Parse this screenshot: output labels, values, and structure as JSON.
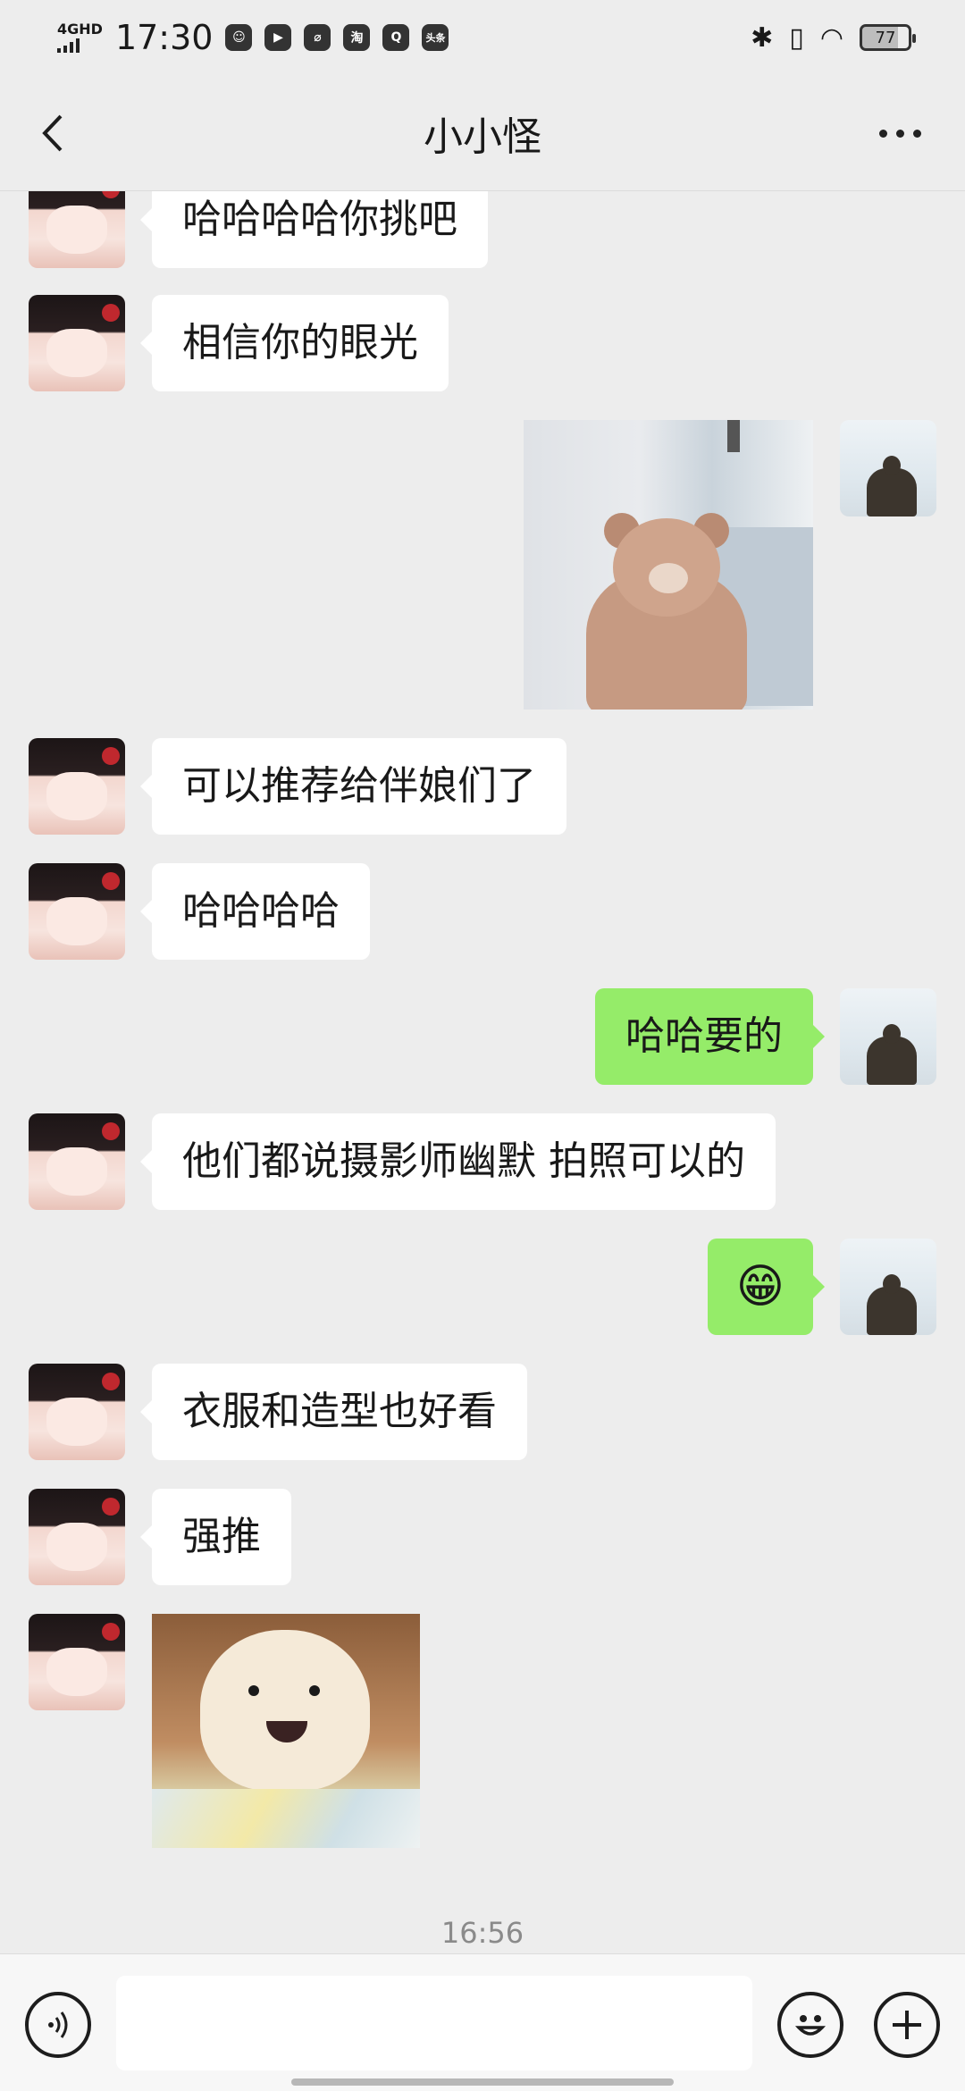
{
  "status_bar": {
    "network": "4GHD",
    "time": "17:30",
    "app_icons": [
      "person-icon",
      "video-icon",
      "leaf-icon",
      "taobao-icon",
      "q-icon",
      "toutiao-icon"
    ],
    "app_labels": [
      "淘",
      "头条"
    ],
    "battery": "77"
  },
  "nav": {
    "title": "小小怪"
  },
  "messages": [
    {
      "from": "them",
      "type": "text",
      "text": "哈哈哈哈你挑吧"
    },
    {
      "from": "them",
      "type": "text",
      "text": "相信你的眼光"
    },
    {
      "from": "me",
      "type": "image",
      "description": "bear-costume-photo"
    },
    {
      "from": "them",
      "type": "text",
      "text": "可以推荐给伴娘们了"
    },
    {
      "from": "them",
      "type": "text",
      "text": "哈哈哈哈"
    },
    {
      "from": "me",
      "type": "text",
      "text": "哈哈要的"
    },
    {
      "from": "them",
      "type": "text",
      "text": "他们都说摄影师幽默 拍照可以的"
    },
    {
      "from": "me",
      "type": "text",
      "text": "😁"
    },
    {
      "from": "them",
      "type": "text",
      "text": "衣服和造型也好看"
    },
    {
      "from": "them",
      "type": "text",
      "text": "强推"
    },
    {
      "from": "them",
      "type": "image",
      "description": "pomeranian-sticker"
    }
  ],
  "timestamp": "16:56",
  "input": {
    "value": "",
    "placeholder": ""
  },
  "colors": {
    "background": "#ededed",
    "outgoing_bubble": "#95ec69",
    "incoming_bubble": "#ffffff"
  }
}
